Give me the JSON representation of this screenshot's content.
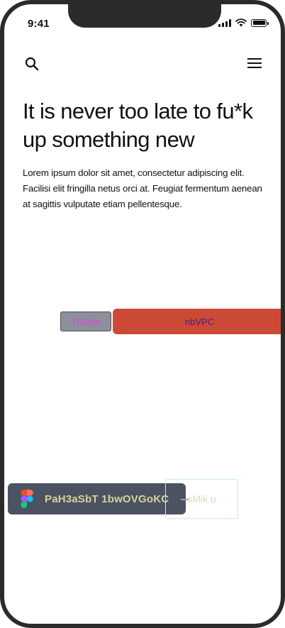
{
  "status_bar": {
    "time": "9:41"
  },
  "nav": {
    "search_icon": "search-icon",
    "menu_icon": "hamburger-menu-icon"
  },
  "hero": {
    "headline": "It is never too late to fu*k up something new",
    "body": "Lorem ipsum dolor sit amet, consectetur adipiscing elit. Facilisi elit fringilla netus orci at. Feugiat fermentum aenean at sagittis vulputate etiam pellentesque."
  },
  "buttons": {
    "grey_label": "TLWqo",
    "red_label": "nbVPC"
  },
  "figma_chip": {
    "label": "PaH3aSbT 1bwOVGoKC",
    "icon": "figma-logo-icon"
  },
  "ghost_button": {
    "label": "sMik u"
  },
  "colors": {
    "red_button": "#cc4935",
    "grey_button": "#8d8f9b",
    "chip_bg": "#4b5262",
    "figma_red": "#f24e1e",
    "figma_orange": "#ff7262",
    "figma_purple": "#a259ff",
    "figma_blue": "#1abcfe",
    "figma_green": "#0acf83"
  }
}
